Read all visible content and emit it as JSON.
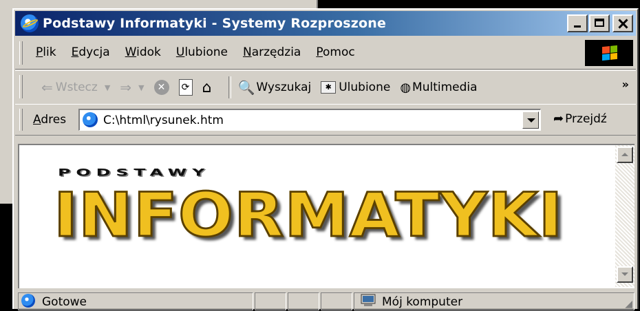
{
  "window": {
    "title": "Podstawy Informatyki - Systemy Rozproszone"
  },
  "menu": {
    "items": [
      "Plik",
      "Edycja",
      "Widok",
      "Ulubione",
      "Narzędzia",
      "Pomoc"
    ]
  },
  "toolbar": {
    "back": "Wstecz",
    "search": "Wyszukaj",
    "favorites": "Ulubione",
    "media": "Multimedia",
    "more": "»"
  },
  "address": {
    "label": "Adres",
    "url": "C:\\html\\rysunek.htm",
    "go": "Przejdź"
  },
  "page": {
    "logo_top": "PODSTAWY",
    "logo_main": "INFORMATYKI"
  },
  "status": {
    "text": "Gotowe",
    "zone": "Mój komputer"
  },
  "colors": {
    "title_start": "#0a246a",
    "title_end": "#a6caf0",
    "chrome": "#d4d0c8",
    "logo_gold": "#f0c020"
  }
}
